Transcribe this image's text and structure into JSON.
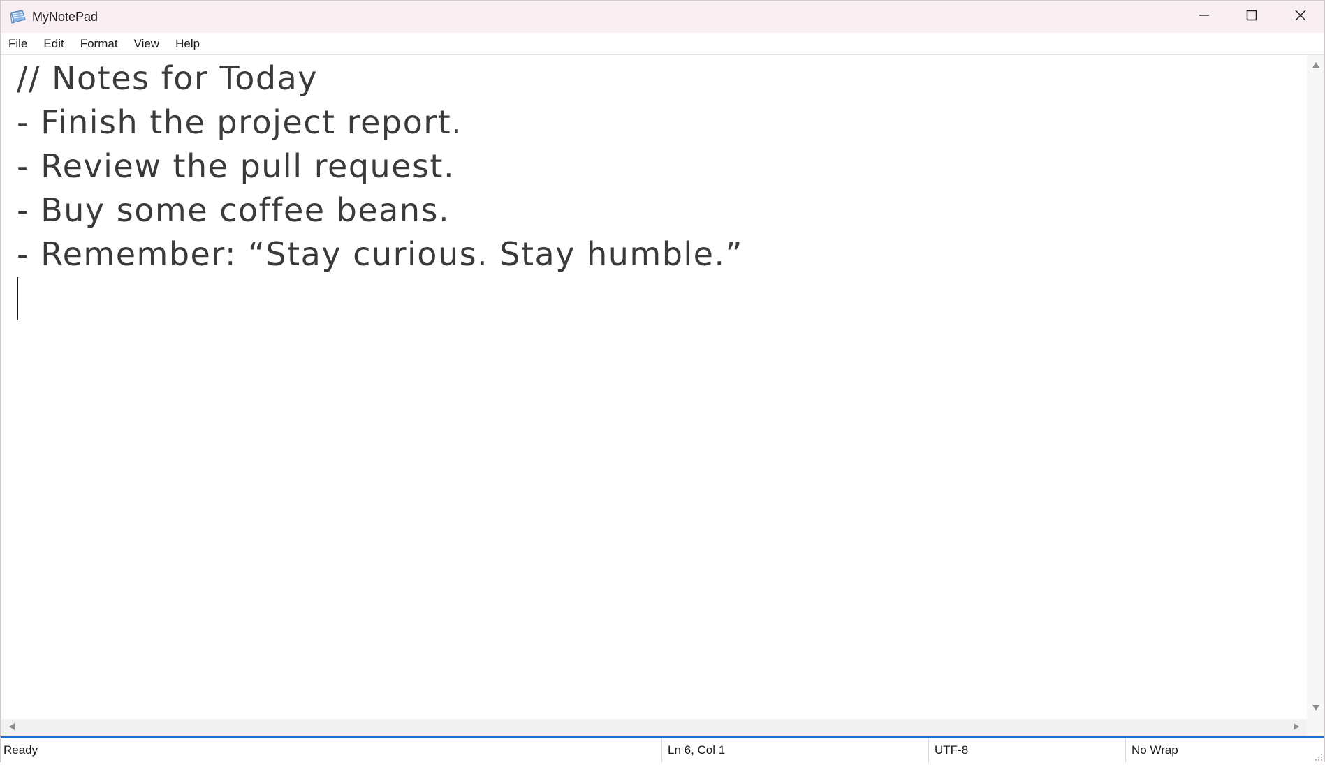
{
  "window": {
    "title": "MyNotePad",
    "app_icon": "notepad-icon",
    "controls": {
      "minimize_icon": "minimize-icon",
      "maximize_icon": "maximize-icon",
      "close_icon": "close-icon"
    }
  },
  "menu": {
    "items": [
      {
        "label": "File"
      },
      {
        "label": "Edit"
      },
      {
        "label": "Format"
      },
      {
        "label": "View"
      },
      {
        "label": "Help"
      }
    ]
  },
  "editor": {
    "lines": [
      "// Notes for Today",
      "- Finish the project report.",
      "- Review the pull request.",
      "- Buy some coffee beans.",
      "- Remember: “Stay curious. Stay humble.”"
    ]
  },
  "status": {
    "state": "Ready",
    "position": "Ln 6, Col 1",
    "encoding": "UTF-8",
    "wrap": "No Wrap"
  },
  "colors": {
    "titlebar_bg": "#f9eef1",
    "status_accent": "#1f6fd1",
    "text": "#3a3a3a"
  }
}
